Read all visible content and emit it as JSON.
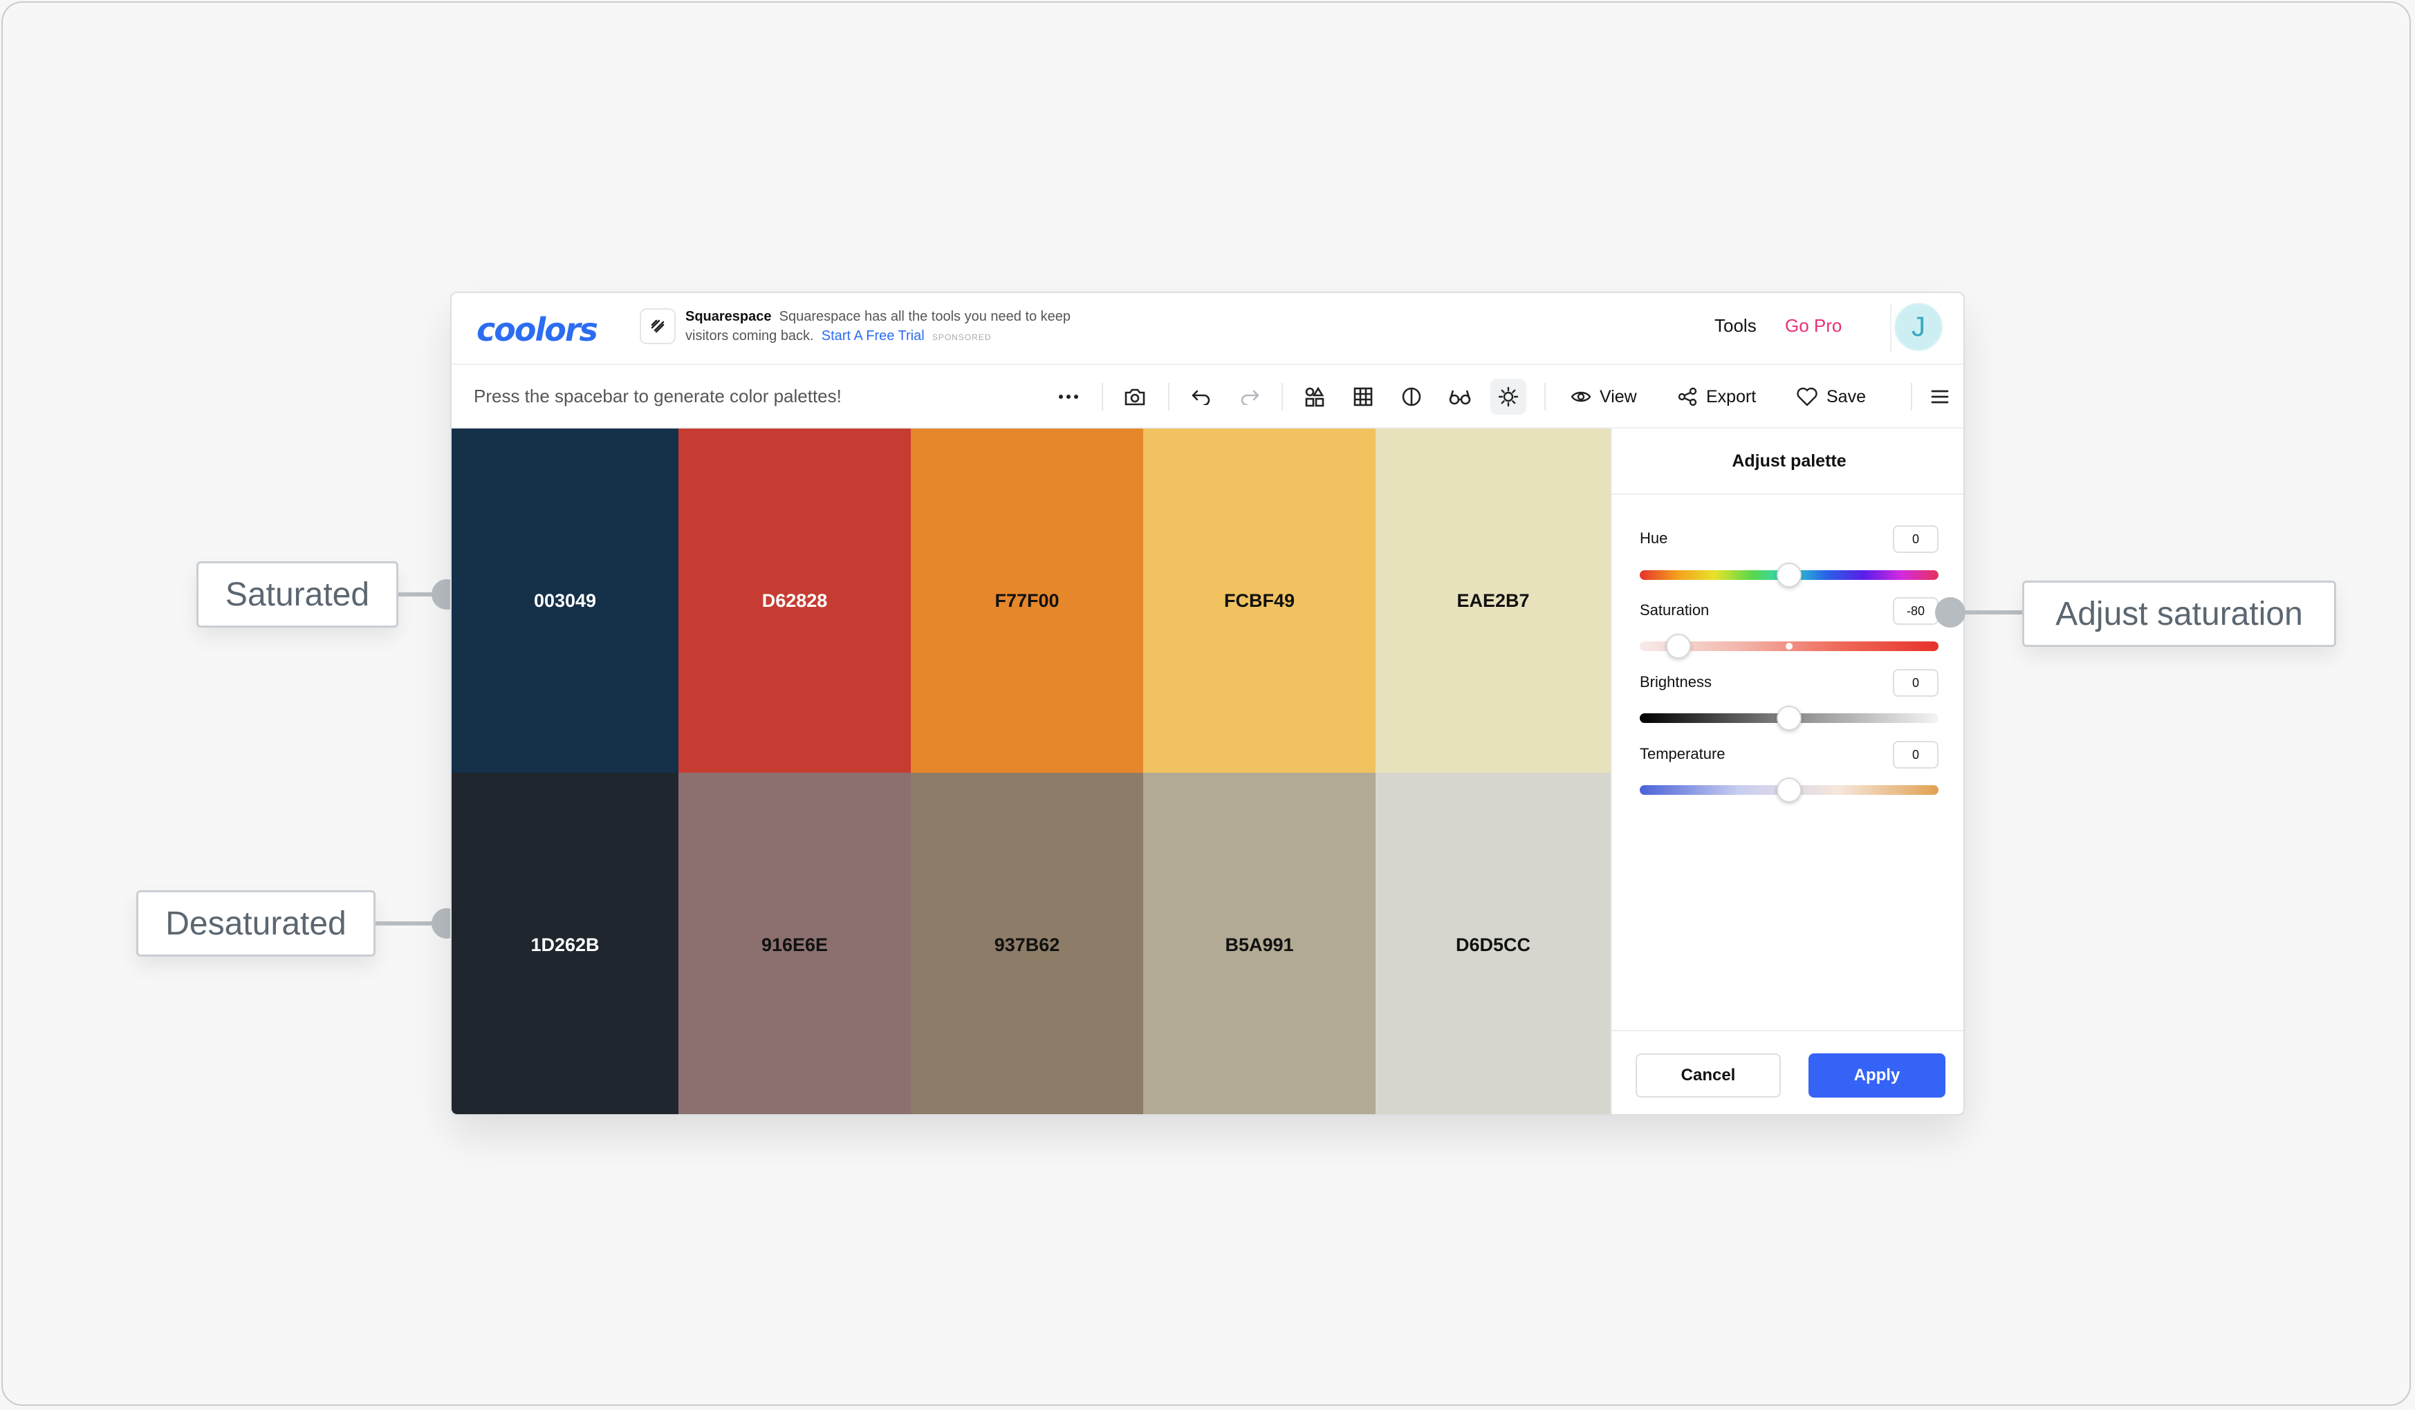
{
  "app": {
    "logo": "coolors",
    "ad": {
      "brand": "Squarespace",
      "text": "Squarespace has all the tools you need to keep visitors coming back.",
      "link": "Start A Free Trial",
      "sponsored": "SPONSORED"
    },
    "nav": {
      "tools": "Tools",
      "gopro": "Go Pro",
      "avatar": "J"
    }
  },
  "toolbar": {
    "hint": "Press the spacebar to generate color palettes!",
    "icons": [
      "more-icon",
      "camera-icon",
      "undo-icon",
      "redo-icon",
      "shapes-icon",
      "grid-icon",
      "contrast-icon",
      "glasses-icon",
      "sun-icon",
      "eye-icon",
      "share-icon",
      "heart-icon",
      "menu-icon"
    ],
    "view_label": "View",
    "export_label": "Export",
    "save_label": "Save"
  },
  "palette": {
    "saturated": [
      {
        "hex": "003049",
        "color": "#153049",
        "text": "#ffffff"
      },
      {
        "hex": "D62828",
        "color": "#c63c32",
        "text": "#ffffff"
      },
      {
        "hex": "F77F00",
        "color": "#e6872c",
        "text": "#111111"
      },
      {
        "hex": "FCBF49",
        "color": "#f1c360",
        "text": "#111111"
      },
      {
        "hex": "EAE2B7",
        "color": "#e8e2bc",
        "text": "#111111"
      }
    ],
    "desaturated": [
      {
        "hex": "1D262B",
        "color": "#1f262d",
        "text": "#ffffff"
      },
      {
        "hex": "916E6E",
        "color": "#8c7070",
        "text": "#111111"
      },
      {
        "hex": "937B62",
        "color": "#8d7c67",
        "text": "#111111"
      },
      {
        "hex": "B5A991",
        "color": "#b2aa94",
        "text": "#111111"
      },
      {
        "hex": "D6D5CC",
        "color": "#d7d6ce",
        "text": "#111111"
      }
    ]
  },
  "panel": {
    "title": "Adjust palette",
    "sliders": [
      {
        "label": "Hue",
        "value": "0",
        "position": 0.5
      },
      {
        "label": "Saturation",
        "value": "-80",
        "position": 0.13
      },
      {
        "label": "Brightness",
        "value": "0",
        "position": 0.5
      },
      {
        "label": "Temperature",
        "value": "0",
        "position": 0.5
      }
    ],
    "cancel": "Cancel",
    "apply": "Apply"
  },
  "callouts": {
    "saturated": "Saturated",
    "desaturated": "Desaturated",
    "adjust": "Adjust saturation"
  }
}
